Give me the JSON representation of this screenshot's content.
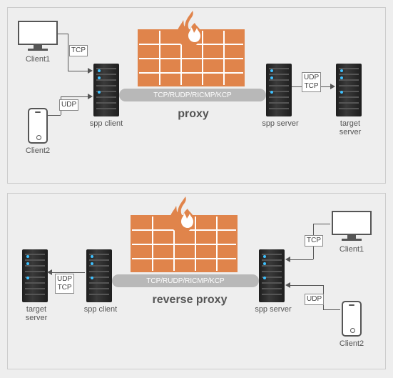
{
  "diagram1": {
    "title": "proxy",
    "client1": "Client1",
    "client2": "Client2",
    "spp_client": "spp client",
    "spp_server": "spp server",
    "target": "target\nserver",
    "tcp": "TCP",
    "udp": "UDP",
    "tunnel": "TCP/RUDP/RICMP/KCP",
    "out_protocols": "UDP\nTCP"
  },
  "diagram2": {
    "title": "reverse proxy",
    "client1": "Client1",
    "client2": "Client2",
    "spp_client": "spp client",
    "spp_server": "spp server",
    "target": "target\nserver",
    "tcp": "TCP",
    "udp": "UDP",
    "tunnel": "TCP/RUDP/RICMP/KCP",
    "out_protocols": "UDP\nTCP"
  },
  "colors": {
    "brick": "#e0844b",
    "flame_outer": "#e0844b",
    "flame_inner": "#ffffff"
  }
}
